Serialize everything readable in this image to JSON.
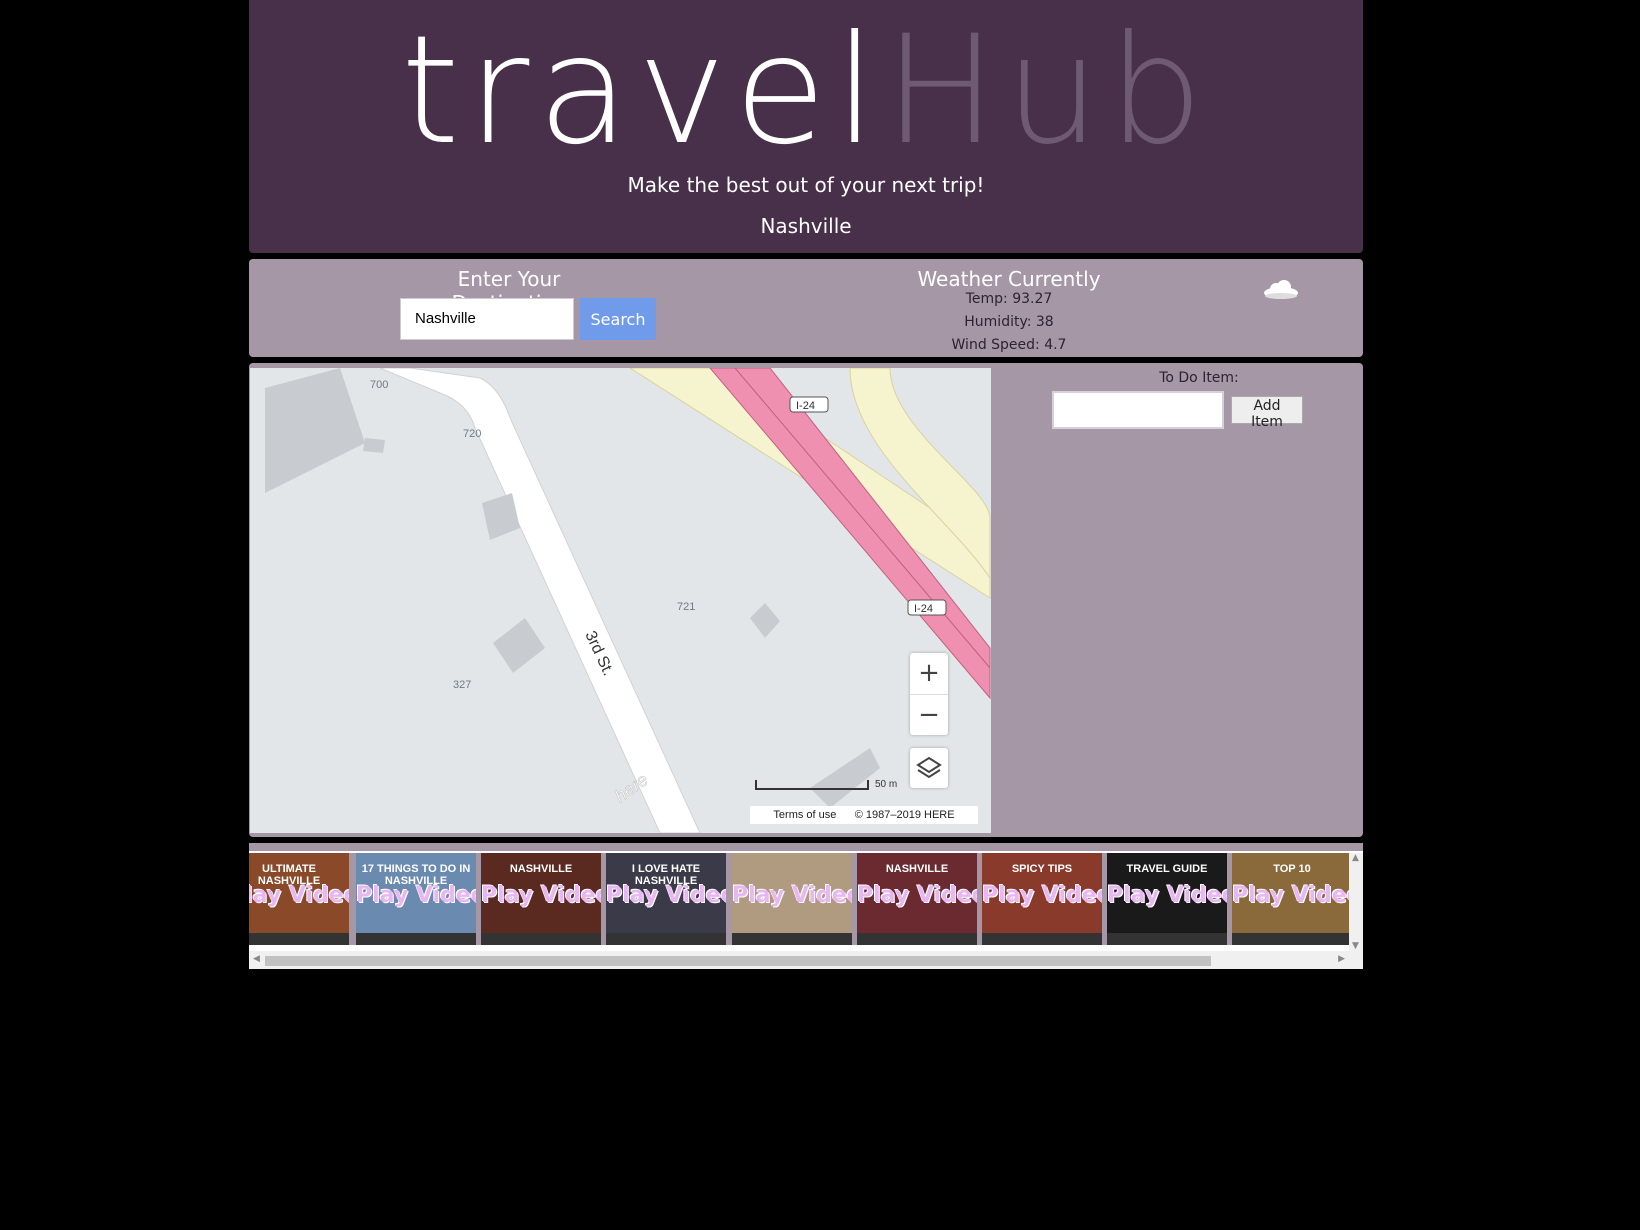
{
  "header": {
    "logo_part1": "travel",
    "logo_part2": "Hub",
    "tagline": "Make the best out of your next trip!",
    "current_city": "Nashville"
  },
  "destination": {
    "title": "Enter Your Destination",
    "input_value": "Nashville",
    "search_label": "Search"
  },
  "weather": {
    "title": "Weather Currently",
    "temp": "Temp: 93.27",
    "humidity": "Humidity: 38",
    "wind": "Wind Speed: 4.7",
    "icon": "cloud-icon"
  },
  "map": {
    "labels": [
      "700",
      "720",
      "721",
      "327",
      "3rd St.",
      "I-24",
      "I-24"
    ],
    "zoom_in": "+",
    "zoom_out": "−",
    "scale": "50 m",
    "terms": "Terms of use",
    "copyright": "© 1987–2019 HERE",
    "watermark": "here"
  },
  "todo": {
    "label": "To Do Item:",
    "input_value": "",
    "add_label": "Add Item"
  },
  "videos": {
    "play_label": "Play Video",
    "thumbnails": [
      {
        "caption": "ULTIMATE NASHVILLE",
        "bg": "#8a4a2a"
      },
      {
        "caption": "17 THINGS TO DO IN NASHVILLE",
        "bg": "#6a8ab0"
      },
      {
        "caption": "NASHVILLE",
        "bg": "#5a2a20"
      },
      {
        "caption": "I LOVE HATE NASHVILLE",
        "bg": "#3a3a48"
      },
      {
        "caption": "",
        "bg": "#b09a80"
      },
      {
        "caption": "NASHVILLE",
        "bg": "#6a2a30"
      },
      {
        "caption": "SPICY TIPS",
        "bg": "#8a3a2a"
      },
      {
        "caption": "TRAVEL GUIDE",
        "bg": "#1a1a1a"
      },
      {
        "caption": "TOP 10",
        "bg": "#8a6a3a"
      }
    ]
  },
  "colors": {
    "header_bg": "#48304a",
    "panel_bg": "#a597a6",
    "search_button": "#6f9bea",
    "highway": "#f090b0"
  }
}
